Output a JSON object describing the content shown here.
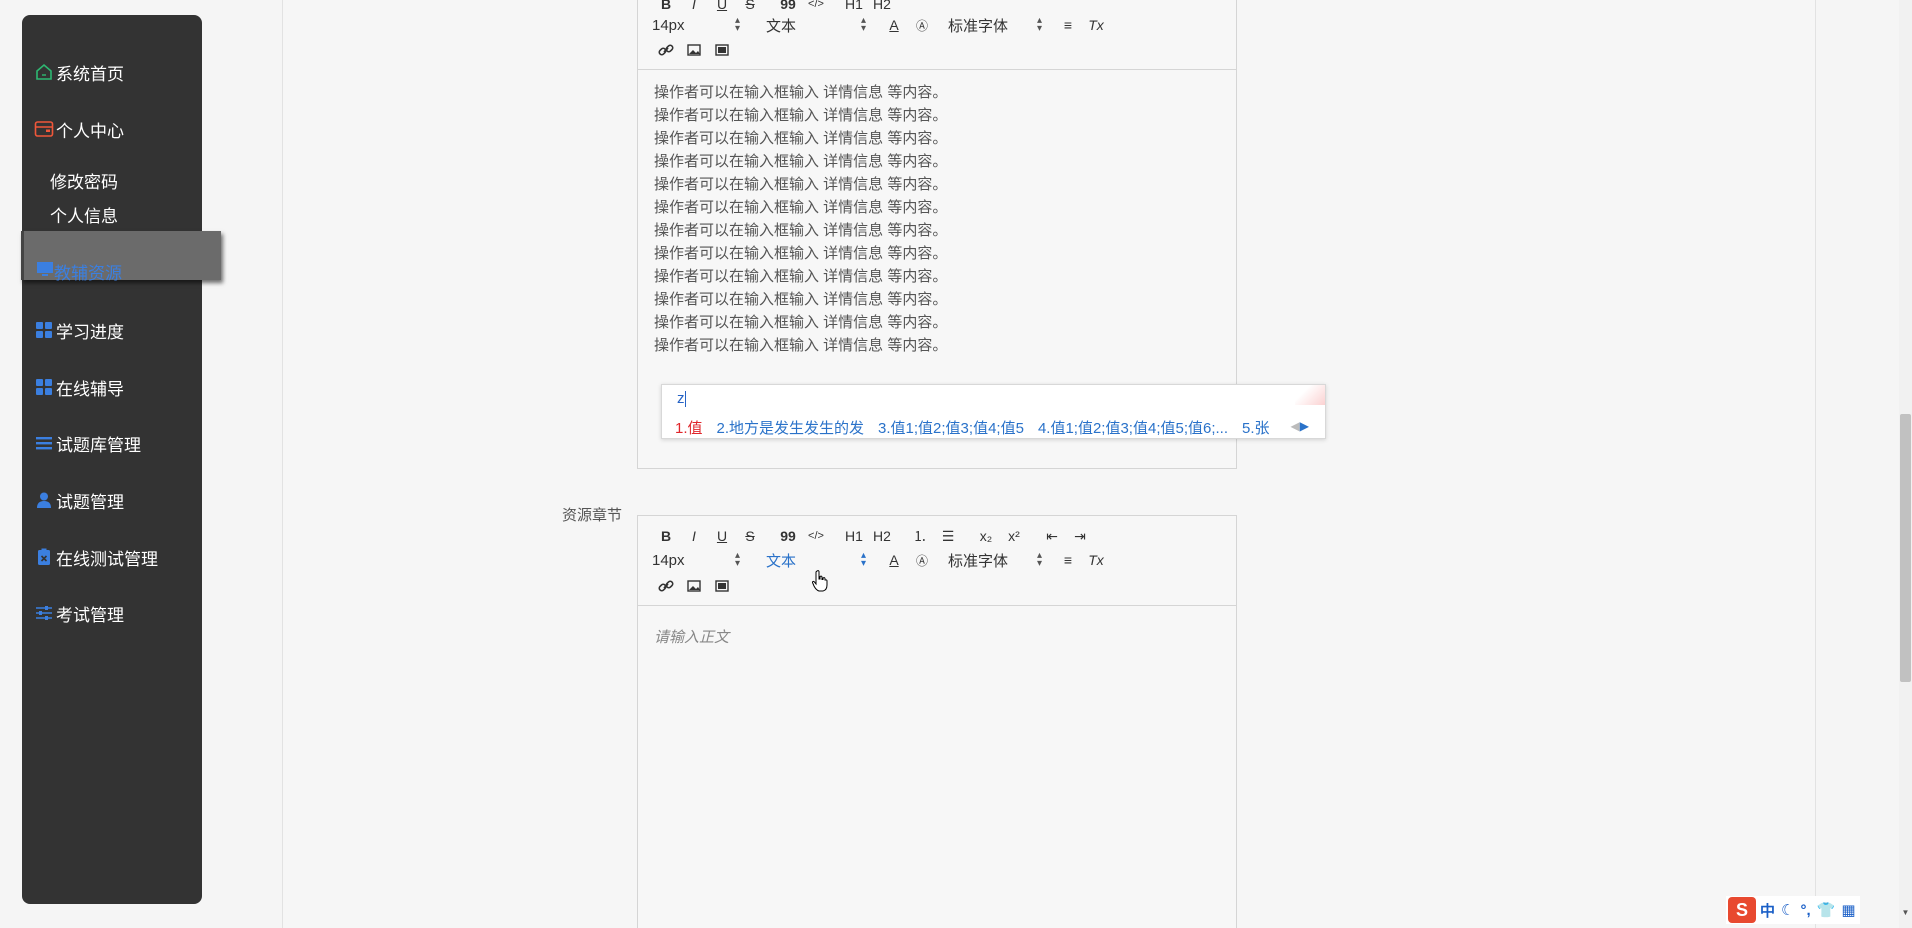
{
  "sidebar": {
    "items": [
      {
        "label": "系统首页",
        "icon": "home-icon",
        "icon_color": "#2eb872"
      },
      {
        "label": "个人中心",
        "icon": "wallet-icon",
        "icon_color": "#f0573a"
      },
      {
        "label": "教辅资源",
        "icon": "monitor-icon",
        "icon_color": "#3b7fe0"
      },
      {
        "label": "学习进度",
        "icon": "grid-icon",
        "icon_color": "#3b7fe0"
      },
      {
        "label": "在线辅导",
        "icon": "grid-icon",
        "icon_color": "#3b7fe0"
      },
      {
        "label": "试题库管理",
        "icon": "list-icon",
        "icon_color": "#3b7fe0"
      },
      {
        "label": "试题管理",
        "icon": "user-icon",
        "icon_color": "#3b7fe0"
      },
      {
        "label": "在线测试管理",
        "icon": "clipboard-icon",
        "icon_color": "#3b7fe0"
      },
      {
        "label": "考试管理",
        "icon": "sliders-icon",
        "icon_color": "#3b7fe0"
      }
    ],
    "submenu": [
      "修改密码",
      "个人信息"
    ],
    "active_color": "#3b7fe0"
  },
  "editor1": {
    "font_size": "14px",
    "block_type": "文本",
    "font_family": "标准字体",
    "lines": [
      "操作者可以在输入框输入 详情信息 等内容。",
      "操作者可以在输入框输入 详情信息 等内容。",
      "操作者可以在输入框输入 详情信息 等内容。",
      "操作者可以在输入框输入 详情信息 等内容。",
      "操作者可以在输入框输入 详情信息 等内容。",
      "操作者可以在输入框输入 详情信息 等内容。",
      "操作者可以在输入框输入 详情信息 等内容。",
      "操作者可以在输入框输入 详情信息 等内容。",
      "操作者可以在输入框输入 详情信息 等内容。",
      "操作者可以在输入框输入 详情信息 等内容。",
      "操作者可以在输入框输入 详情信息 等内容。",
      "操作者可以在输入框输入 详情信息 等内容。"
    ]
  },
  "ime": {
    "input": "z",
    "candidates": [
      "1.值",
      "2.地方是发生发生的发",
      "3.值1;值2;值3;值4;值5",
      "4.值1;值2;值3;值4;值5;值6;...",
      "5.张"
    ]
  },
  "editor2": {
    "label": "资源章节",
    "font_size": "14px",
    "block_type": "文本",
    "font_family": "标准字体",
    "placeholder": "请输入正文",
    "toolbar": {
      "bold": "B",
      "italic": "I",
      "underline": "U",
      "strike": "S",
      "quote": "99",
      "code": "</>",
      "h1": "H1",
      "h2": "H2",
      "subscript": "x₂",
      "superscript": "x²",
      "clear_format": "Tx"
    }
  },
  "tray": {
    "logo": "S",
    "lang": "中"
  }
}
